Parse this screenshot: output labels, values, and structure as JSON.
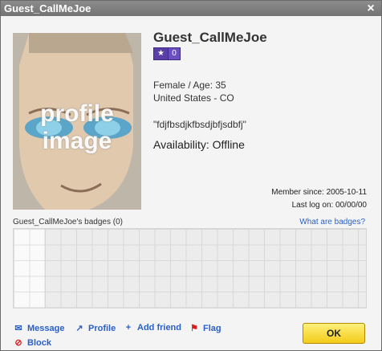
{
  "window": {
    "title": "Guest_CallMeJoe"
  },
  "profile": {
    "name": "Guest_CallMeJoe",
    "badge_count": "0",
    "image_text_line1": "profile",
    "image_text_line2": "image",
    "gender_age": "Female / Age: 35",
    "location": "United States - CO",
    "motto": "\"fdjfbsdjkfbsdjbfjsdbfj\"",
    "availability": "Availability: Offline",
    "member_since": "Member since: 2005-10-11",
    "last_logon": "Last log on: 00/00/00"
  },
  "badges": {
    "label": "Guest_CallMeJoe's badges (0)",
    "help_link": "What are badges?"
  },
  "actions": {
    "message": "Message",
    "profile": "Profile",
    "add_friend": "Add friend",
    "flag": "Flag",
    "block": "Block"
  },
  "buttons": {
    "ok": "OK"
  },
  "colors": {
    "link": "#2a5fc8",
    "ok_button": "#f3cc1a",
    "titlebar": "#7f7f7f",
    "badge": "#5b3fa8"
  }
}
